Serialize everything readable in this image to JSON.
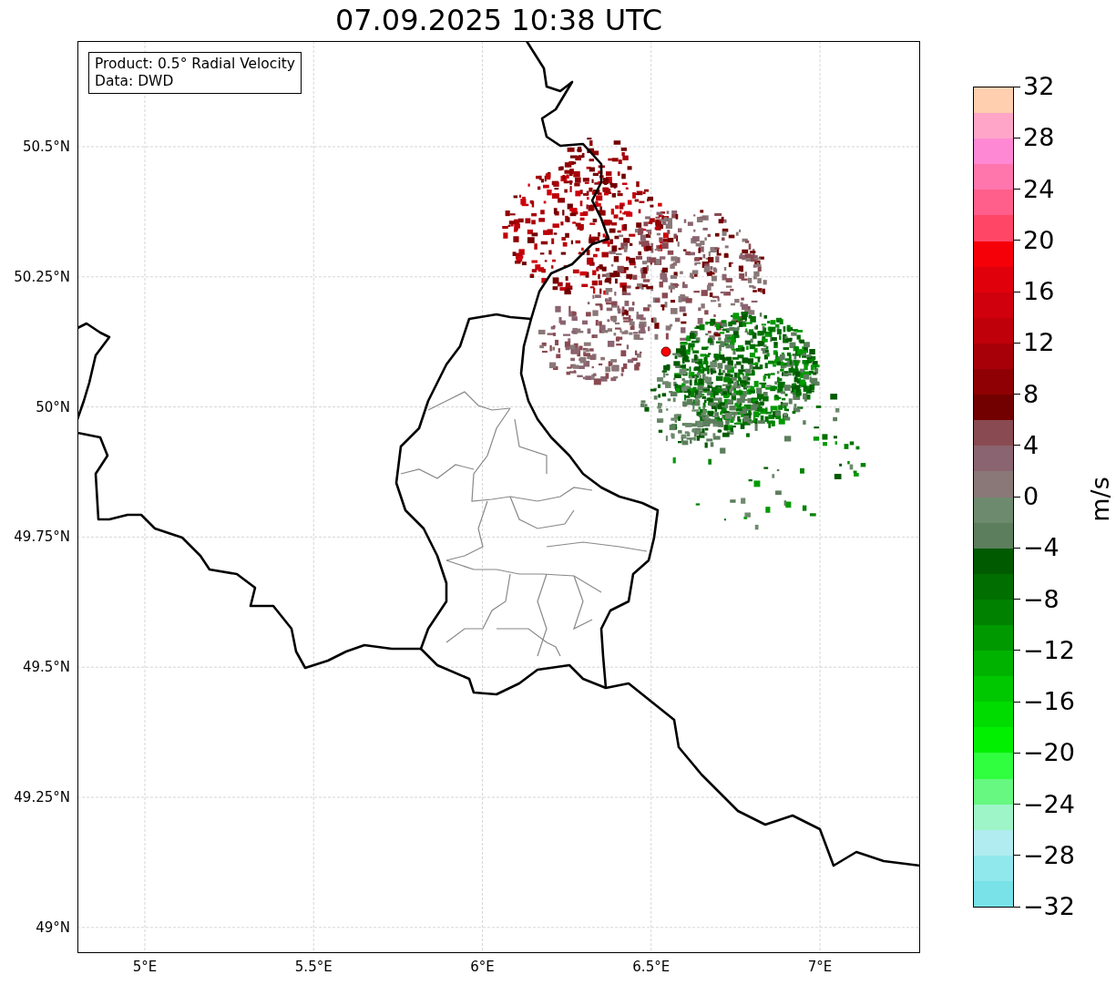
{
  "title": "07.09.2025 10:38 UTC",
  "info_box": {
    "lines": [
      "Product: 0.5° Radial Velocity",
      "Data: DWD"
    ]
  },
  "y_ticks": [
    "50.5°N",
    "50.25°N",
    "50°N",
    "49.75°N",
    "49.5°N",
    "49.25°N",
    "49°N"
  ],
  "x_ticks": [
    "5°E",
    "5.5°E",
    "6°E",
    "6.5°E",
    "7°E"
  ],
  "colorbar": {
    "label": "m/s",
    "ticks": [
      "32",
      "28",
      "24",
      "20",
      "16",
      "12",
      "8",
      "4",
      "0",
      "−4",
      "−8",
      "−12",
      "−16",
      "−20",
      "−24",
      "−28",
      "−32"
    ],
    "bands": [
      {
        "color": "#ffcfb0"
      },
      {
        "color": "#ffa6c8"
      },
      {
        "color": "#ff88d4"
      },
      {
        "color": "#ff76ac"
      },
      {
        "color": "#ff5f8a"
      },
      {
        "color": "#ff4666"
      },
      {
        "color": "#f50008"
      },
      {
        "color": "#e0000c"
      },
      {
        "color": "#d0000c"
      },
      {
        "color": "#bf000a"
      },
      {
        "color": "#a80008"
      },
      {
        "color": "#8f0004"
      },
      {
        "color": "#720000"
      },
      {
        "color": "#8a4a52"
      },
      {
        "color": "#8a6470"
      },
      {
        "color": "#8a7878"
      },
      {
        "color": "#6e8a6e"
      },
      {
        "color": "#5c7e5c"
      },
      {
        "color": "#005a00"
      },
      {
        "color": "#006e00"
      },
      {
        "color": "#008200"
      },
      {
        "color": "#009a00"
      },
      {
        "color": "#00b200"
      },
      {
        "color": "#00c800"
      },
      {
        "color": "#00dc00"
      },
      {
        "color": "#00f000"
      },
      {
        "color": "#30ff40"
      },
      {
        "color": "#66f880"
      },
      {
        "color": "#9ef5c8"
      },
      {
        "color": "#b0ecf0"
      },
      {
        "color": "#90e8ec"
      },
      {
        "color": "#78e2e8"
      }
    ]
  }
}
